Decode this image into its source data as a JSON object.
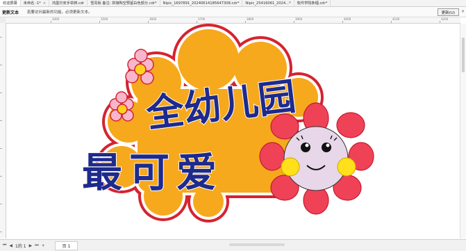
{
  "tabs": [
    {
      "label": "欢迎屏幕"
    },
    {
      "label": "未命名 -1*"
    },
    {
      "label": "鸿墨尔克手举牌.cdr"
    },
    {
      "label": "雪青板 备注: 拼接陶空预留白色部分.cdr*"
    },
    {
      "label": "Nipic_1697891_20240614185647308.cdr*"
    },
    {
      "label": "Nipic_25416061_2024...*"
    },
    {
      "label": "软件学院条幅.cdr*"
    }
  ],
  "notice": {
    "title": "更新文本",
    "message": "若要访问最新的功能，必须更新文本。",
    "button": "更新(U)",
    "close": "×"
  },
  "ruler": {
    "ticks": [
      "3400",
      "3500",
      "3600",
      "3700",
      "3800",
      "3900",
      "4000",
      "4100",
      "4200"
    ]
  },
  "artwork": {
    "line1": "全幼儿园",
    "line2": "最可爱"
  },
  "pagebar": {
    "first": "⏮",
    "prev": "◀",
    "page_info": "1的 1",
    "next": "▶",
    "last": "⏭",
    "add": "+",
    "page_tab": "页 1"
  },
  "colors": {
    "cloud_orange": "#f6a91c",
    "cloud_red": "#d52330",
    "text_navy": "#1e2a8c",
    "petal_red": "#f04257",
    "face": "#e7d7e8",
    "cheek": "#ffe01a",
    "small_flower_pink": "#f7b6cc",
    "small_flower_center": "#ffd21e"
  }
}
